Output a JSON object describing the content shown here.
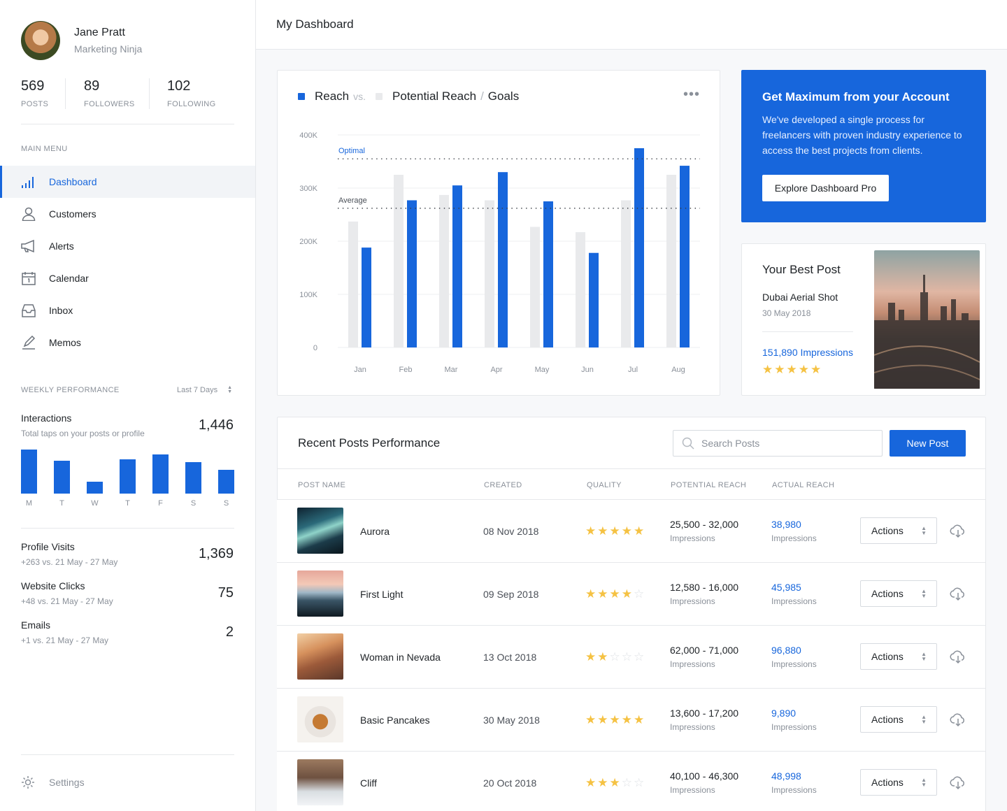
{
  "profile": {
    "name": "Jane Pratt",
    "role": "Marketing Ninja"
  },
  "stats": [
    {
      "value": "569",
      "label": "POSTS"
    },
    {
      "value": "89",
      "label": "FOLLOWERS"
    },
    {
      "value": "102",
      "label": "FOLLOWING"
    }
  ],
  "menu": {
    "title": "MAIN MENU",
    "items": [
      {
        "label": "Dashboard",
        "icon": "bar-chart-icon",
        "active": true
      },
      {
        "label": "Customers",
        "icon": "user-icon"
      },
      {
        "label": "Alerts",
        "icon": "megaphone-icon"
      },
      {
        "label": "Calendar",
        "icon": "calendar-icon"
      },
      {
        "label": "Inbox",
        "icon": "inbox-icon"
      },
      {
        "label": "Memos",
        "icon": "pencil-icon"
      }
    ]
  },
  "weekly": {
    "title": "WEEKLY PERFORMANCE",
    "range": "Last 7 Days",
    "interactions": {
      "title": "Interactions",
      "sub": "Total taps on your posts or profile",
      "value": "1,446"
    },
    "days": [
      "M",
      "T",
      "W",
      "T",
      "F",
      "S",
      "S"
    ],
    "day_values": [
      0.95,
      0.71,
      0.26,
      0.74,
      0.85,
      0.68,
      0.52
    ],
    "metrics": [
      {
        "title": "Profile Visits",
        "sub": "+263 vs. 21 May - 27 May",
        "value": "1,369"
      },
      {
        "title": "Website Clicks",
        "sub": "+48 vs. 21 May - 27 May",
        "value": "75"
      },
      {
        "title": "Emails",
        "sub": "+1 vs. 21 May - 27 May",
        "value": "2"
      }
    ]
  },
  "settings_label": "Settings",
  "page_title": "My Dashboard",
  "chart_data": {
    "type": "bar",
    "legend": {
      "reach": "Reach",
      "vs": "vs.",
      "potential": "Potential Reach",
      "slash": "/",
      "goals": "Goals"
    },
    "categories": [
      "Jan",
      "Feb",
      "Mar",
      "Apr",
      "May",
      "Jun",
      "Jul",
      "Aug"
    ],
    "series": [
      {
        "name": "Potential Reach",
        "color": "#e9eaec",
        "values": [
          237000,
          325000,
          287000,
          277000,
          227000,
          217000,
          277000,
          325000
        ]
      },
      {
        "name": "Reach",
        "color": "#1766dc",
        "values": [
          188000,
          277000,
          305000,
          330000,
          275000,
          178000,
          375000,
          342000
        ]
      }
    ],
    "yticks": [
      "400K",
      "300K",
      "200K",
      "100K",
      "0"
    ],
    "ylim": [
      0,
      400000
    ],
    "goals": [
      {
        "label": "Optimal",
        "value": 355000
      },
      {
        "label": "Average",
        "value": 262000
      }
    ],
    "grid": true
  },
  "promo": {
    "title": "Get Maximum from your Account",
    "text": "We've developed a single process for freelancers with proven industry experience to access the best projects from clients.",
    "button": "Explore Dashboard Pro"
  },
  "best_post": {
    "title": "Your Best Post",
    "name": "Dubai Aerial Shot",
    "date": "30 May 2018",
    "impressions": "151,890 Impressions",
    "rating": 5
  },
  "recent": {
    "title": "Recent Posts Performance",
    "search_placeholder": "Search Posts",
    "new_button": "New Post",
    "columns": [
      "POST NAME",
      "CREATED",
      "QUALITY",
      "POTENTIAL REACH",
      "ACTUAL REACH"
    ],
    "impressions_label": "Impressions",
    "actions_label": "Actions",
    "rows": [
      {
        "name": "Aurora",
        "created": "08 Nov 2018",
        "rating": 5,
        "potential": "25,500 - 32,000",
        "actual": "38,980"
      },
      {
        "name": "First Light",
        "created": "09 Sep 2018",
        "rating": 4,
        "potential": "12,580 - 16,000",
        "actual": "45,985"
      },
      {
        "name": "Woman in Nevada",
        "created": "13 Oct 2018",
        "rating": 2,
        "potential": "62,000 - 71,000",
        "actual": "96,880"
      },
      {
        "name": "Basic Pancakes",
        "created": "30 May 2018",
        "rating": 5,
        "potential": "13,600 - 17,200",
        "actual": "9,890"
      },
      {
        "name": "Cliff",
        "created": "20 Oct 2018",
        "rating": 3,
        "potential": "40,100 - 46,300",
        "actual": "48,998"
      }
    ]
  }
}
